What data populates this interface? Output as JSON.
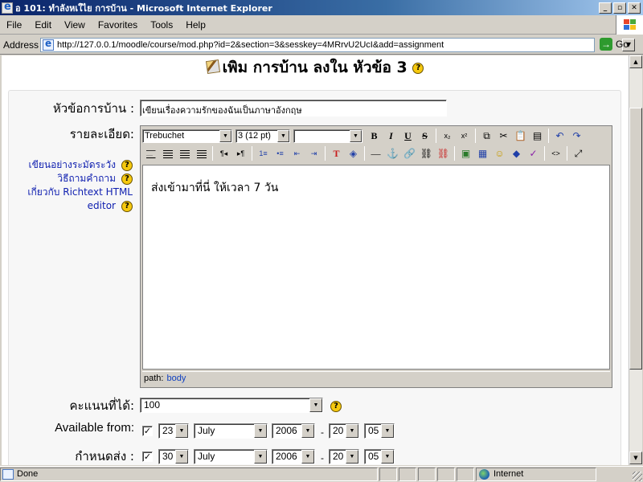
{
  "window": {
    "title": "อ 101: ทำลังหเใไย การบ้าน - Microsoft Internet Explorer"
  },
  "menu": [
    "File",
    "Edit",
    "View",
    "Favorites",
    "Tools",
    "Help"
  ],
  "address": {
    "label": "Address",
    "url": "http://127.0.0.1/moodle/course/mod.php?id=2&section=3&sesskey=4MRrvU2UcI&add=assignment",
    "go_label": "Go"
  },
  "page": {
    "heading": "เพิม การบ้าน ลงใน หัวข้อ 3"
  },
  "form": {
    "name_label": "หัวข้อการบ้าน :",
    "name_value": "เขียนเรื่องความรักของฉันเป็นภาษาอังกฤษ",
    "description_label": "รายละเอียด:",
    "help_links": {
      "line1": "เขียนอย่างระมัดระวัง",
      "line2": "วิธีถามคำถาม",
      "line3": "เกี่ยวกับ Richtext HTML",
      "line4": "editor"
    },
    "editor": {
      "font": "Trebuchet",
      "size": "3 (12 pt)",
      "format": "",
      "content": "ส่งเข้ามาที่นี่ ให้เวลา 7 วัน",
      "path_label": "path:",
      "path_value": "body"
    },
    "grade_label": "คะแนนที่ได้:",
    "grade_value": "100",
    "available_label": "Available from:",
    "available": {
      "checked": true,
      "day": "23",
      "month": "July",
      "year": "2006",
      "hour": "20",
      "minute": "05"
    },
    "due_label": "กำหนดส่ง :",
    "due": {
      "checked": true,
      "day": "30",
      "month": "July",
      "year": "2006",
      "hour": "20",
      "minute": "05"
    },
    "time_separator": "-"
  },
  "status": {
    "left": "Done",
    "zone": "Internet"
  }
}
